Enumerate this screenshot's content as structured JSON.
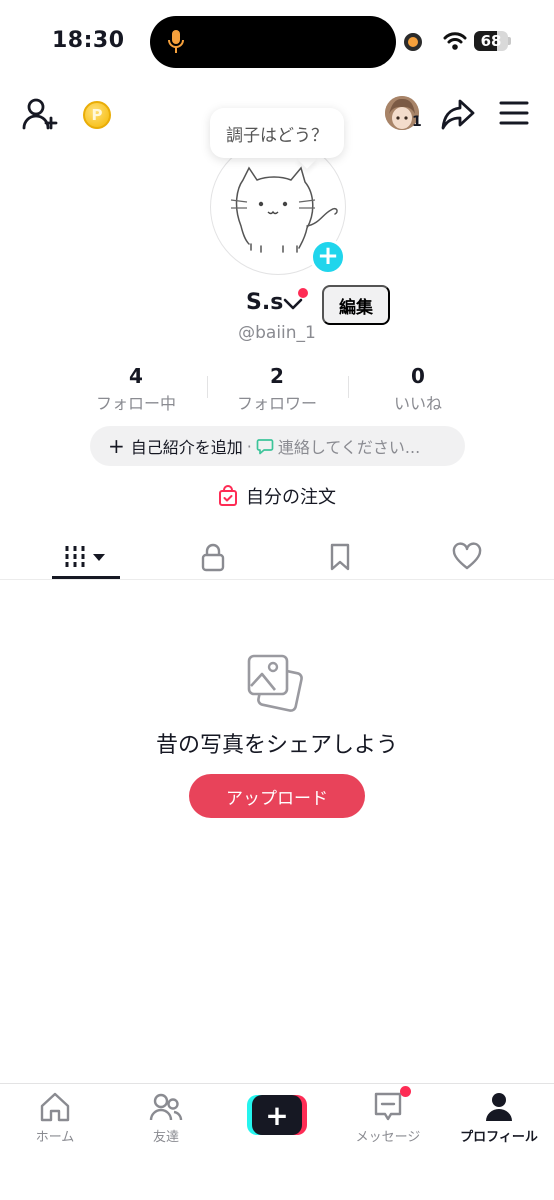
{
  "status_bar": {
    "time": "18:30",
    "battery": "68",
    "battery_level": 0.68
  },
  "header": {
    "coin_label": "P",
    "mini_avatar_count": "1"
  },
  "profile": {
    "bubble_text": "調子はどう？",
    "name": "S.s",
    "edit_label": "編集",
    "handle": "@baiin_1"
  },
  "stats": [
    {
      "value": "4",
      "label": "フォロー中"
    },
    {
      "value": "2",
      "label": "フォロワー"
    },
    {
      "value": "0",
      "label": "いいね"
    }
  ],
  "bio": {
    "add_label": "自己紹介を追加",
    "separator": "·",
    "contact_label": "連絡してください..."
  },
  "orders_label": "自分の注文",
  "tabs": [
    {
      "icon": "grid-icon",
      "active": true
    },
    {
      "icon": "lock-icon",
      "active": false
    },
    {
      "icon": "bookmark-icon",
      "active": false
    },
    {
      "icon": "heart-icon",
      "active": false
    }
  ],
  "empty_state": {
    "title": "昔の写真をシェアしよう",
    "button": "アップロード"
  },
  "bottom_nav": [
    {
      "label": "ホーム",
      "icon": "home-icon"
    },
    {
      "label": "友達",
      "icon": "friends-icon"
    },
    {
      "label": "",
      "icon": "create-icon"
    },
    {
      "label": "メッセージ",
      "icon": "inbox-icon"
    },
    {
      "label": "プロフィール",
      "icon": "profile-icon",
      "active": true
    }
  ],
  "colors": {
    "accent": "#fe2c55",
    "upload_button": "#e8435a",
    "cyan": "#20d5ec",
    "text": "#161823",
    "muted": "#8a8b91"
  }
}
